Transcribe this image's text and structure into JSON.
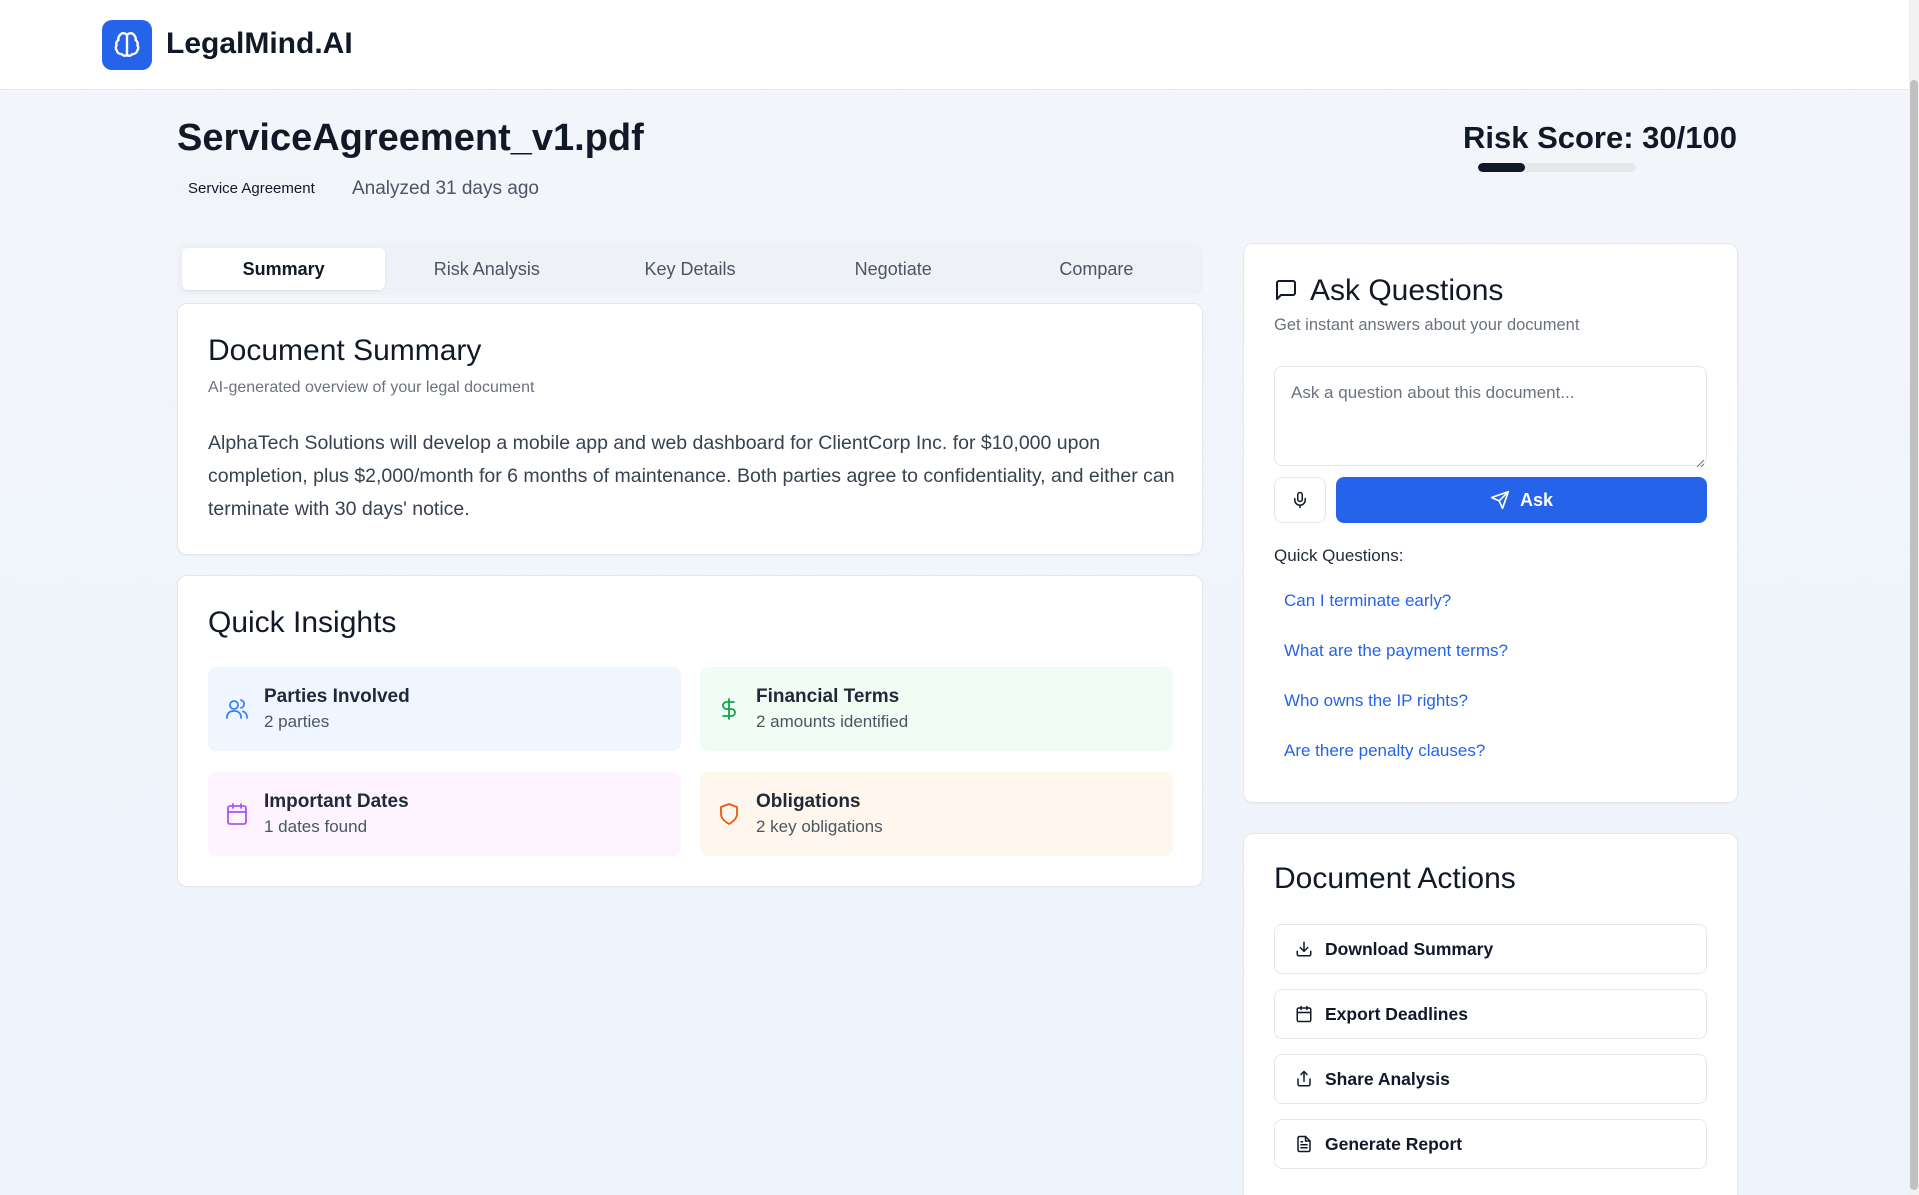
{
  "app": {
    "name": "LegalMind.AI"
  },
  "document": {
    "title": "ServiceAgreement_v1.pdf",
    "type_badge": "Service Agreement",
    "analyzed": "Analyzed 31 days ago",
    "risk_label": "Risk Score: 30/100",
    "risk_score": 30,
    "risk_max": 100
  },
  "tabs": [
    {
      "label": "Summary",
      "active": true
    },
    {
      "label": "Risk Analysis",
      "active": false
    },
    {
      "label": "Key Details",
      "active": false
    },
    {
      "label": "Negotiate",
      "active": false
    },
    {
      "label": "Compare",
      "active": false
    }
  ],
  "summary": {
    "title": "Document Summary",
    "subtitle": "AI-generated overview of your legal document",
    "text": "AlphaTech Solutions will develop a mobile app and web dashboard for ClientCorp Inc. for $10,000 upon completion, plus $2,000/month for 6 months of maintenance. Both parties agree to confidentiality, and either can terminate with 30 days' notice."
  },
  "insights": {
    "title": "Quick Insights",
    "items": [
      {
        "title": "Parties Involved",
        "value": "2 parties",
        "icon": "users-icon",
        "bg": "#eff6ff",
        "color": "#3b82f6"
      },
      {
        "title": "Financial Terms",
        "value": "2 amounts identified",
        "icon": "dollar-icon",
        "bg": "#f0fdf4",
        "color": "#16a34a"
      },
      {
        "title": "Important Dates",
        "value": "1 dates found",
        "icon": "calendar-icon",
        "bg": "#fdf4ff",
        "color": "#a855f7"
      },
      {
        "title": "Obligations",
        "value": "2 key obligations",
        "icon": "shield-icon",
        "bg": "#fff7ed",
        "color": "#ea580c"
      }
    ]
  },
  "ask": {
    "title": "Ask Questions",
    "subtitle": "Get instant answers about your document",
    "placeholder": "Ask a question about this document...",
    "button_label": "Ask",
    "quick_label": "Quick Questions:",
    "quick_questions": [
      "Can I terminate early?",
      "What are the payment terms?",
      "Who owns the IP rights?",
      "Are there penalty clauses?"
    ]
  },
  "actions": {
    "title": "Document Actions",
    "items": [
      {
        "label": "Download Summary",
        "icon": "download-icon"
      },
      {
        "label": "Export Deadlines",
        "icon": "calendar-icon"
      },
      {
        "label": "Share Analysis",
        "icon": "share-icon"
      },
      {
        "label": "Generate Report",
        "icon": "file-text-icon"
      }
    ]
  },
  "colors": {
    "primary": "#2563eb",
    "text": "#111827",
    "muted": "#6b7280"
  }
}
